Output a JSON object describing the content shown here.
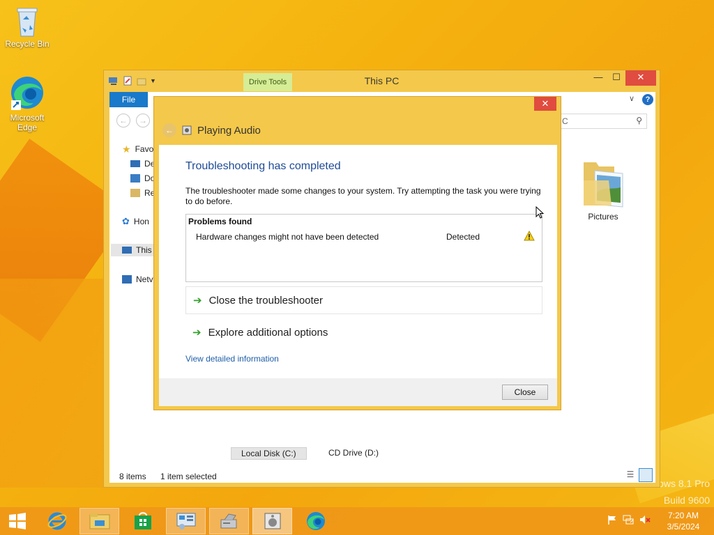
{
  "desktop": {
    "icons": [
      {
        "label": "Recycle Bin"
      },
      {
        "label": "Microsoft Edge"
      }
    ],
    "watermark": {
      "line1": "ows 8.1 Pro",
      "line2": "Build 9600"
    }
  },
  "explorer": {
    "title": "This PC",
    "drive_tools_tab": "Drive Tools",
    "file_tab": "File",
    "search_text": "C",
    "sidebar": [
      "Favo",
      "De",
      "Do",
      "Re",
      "Hon",
      "This",
      "Netv"
    ],
    "pictures_label": "Pictures",
    "drives": [
      "Local Disk (C:)",
      "CD Drive (D:)"
    ],
    "status_items": "8 items",
    "status_selected": "1 item selected"
  },
  "dialog": {
    "title": "Playing Audio",
    "heading": "Troubleshooting has completed",
    "description": "The troubleshooter made some changes to your system. Try attempting the task you were trying to do before.",
    "problems_title": "Problems found",
    "problem": {
      "text": "Hardware changes might not have been detected",
      "status": "Detected"
    },
    "action_close": "Close the troubleshooter",
    "action_explore": "Explore additional options",
    "detail_link": "View detailed information",
    "close_button": "Close"
  },
  "taskbar": {
    "clock_time": "7:20 AM",
    "clock_date": "3/5/2024"
  },
  "colors": {
    "accent_blue": "#1979ca",
    "heading_blue": "#1f4b96",
    "close_red": "#e04c3f",
    "drive_tools_green": "#d6ec95",
    "desktop_orange": "#f5b20f"
  }
}
